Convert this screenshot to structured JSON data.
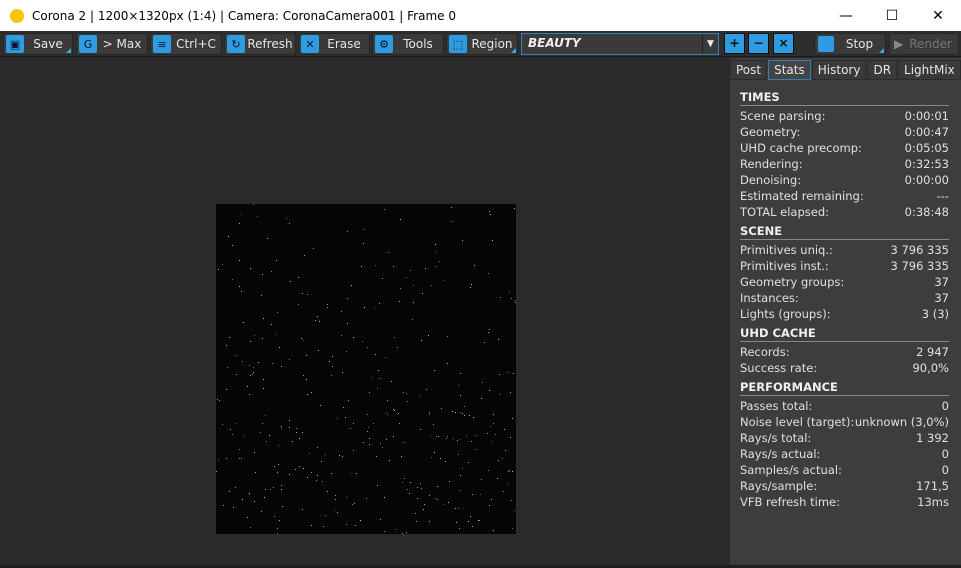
{
  "window": {
    "title": "Corona 2 | 1200×1320px (1:4) | Camera: CoronaCamera001 | Frame 0",
    "minimize": "—",
    "maximize": "☐",
    "close": "✕"
  },
  "toolbar": {
    "buttons": [
      {
        "label": "Save",
        "icon": "save-icon",
        "glyph": "▣"
      },
      {
        "label": "> Max",
        "icon": "max-icon",
        "glyph": "G"
      },
      {
        "label": "Ctrl+C",
        "icon": "copy-icon",
        "glyph": "≡"
      },
      {
        "label": "Refresh",
        "icon": "refresh-icon",
        "glyph": "↻"
      },
      {
        "label": "Erase",
        "icon": "erase-icon",
        "glyph": "✕"
      },
      {
        "label": "Tools",
        "icon": "gear-icon",
        "glyph": "⚙"
      },
      {
        "label": "Region",
        "icon": "region-icon",
        "glyph": "⬚"
      }
    ],
    "channel": "BEAUTY",
    "zoom_in": "+",
    "zoom_out": "−",
    "zoom_fit": "×",
    "stop": "Stop",
    "render": "Render"
  },
  "panel": {
    "tabs": [
      "Post",
      "Stats",
      "History",
      "DR",
      "LightMix"
    ],
    "active_tab": "Stats",
    "sections": [
      {
        "title": "TIMES",
        "rows": [
          [
            "Scene parsing:",
            "0:00:01"
          ],
          [
            "Geometry:",
            "0:00:47"
          ],
          [
            "UHD cache precomp:",
            "0:05:05"
          ],
          [
            "Rendering:",
            "0:32:53"
          ],
          [
            "Denoising:",
            "0:00:00"
          ],
          [
            "Estimated remaining:",
            "---"
          ],
          [
            "TOTAL elapsed:",
            "0:38:48"
          ]
        ]
      },
      {
        "title": "SCENE",
        "rows": [
          [
            "Primitives uniq.:",
            "3 796 335"
          ],
          [
            "Primitives inst.:",
            "3 796 335"
          ],
          [
            "Geometry groups:",
            "37"
          ],
          [
            "Instances:",
            "37"
          ],
          [
            "Lights (groups):",
            "3 (3)"
          ]
        ]
      },
      {
        "title": "UHD CACHE",
        "rows": [
          [
            "Records:",
            "2 947"
          ],
          [
            "Success rate:",
            "90,0%"
          ]
        ]
      },
      {
        "title": "PERFORMANCE",
        "rows": [
          [
            "Passes total:",
            "0"
          ],
          [
            "Noise level (target):",
            "unknown (3,0%)"
          ],
          [
            "Rays/s total:",
            "1 392"
          ],
          [
            "Rays/s actual:",
            "0"
          ],
          [
            "Samples/s actual:",
            "0"
          ],
          [
            "Rays/sample:",
            "171,5"
          ],
          [
            "VFB refresh time:",
            "13ms"
          ]
        ]
      }
    ]
  },
  "colors": {
    "accent": "#2f9be0",
    "background": "#2a2a2a",
    "panel": "#3d3d3d"
  }
}
